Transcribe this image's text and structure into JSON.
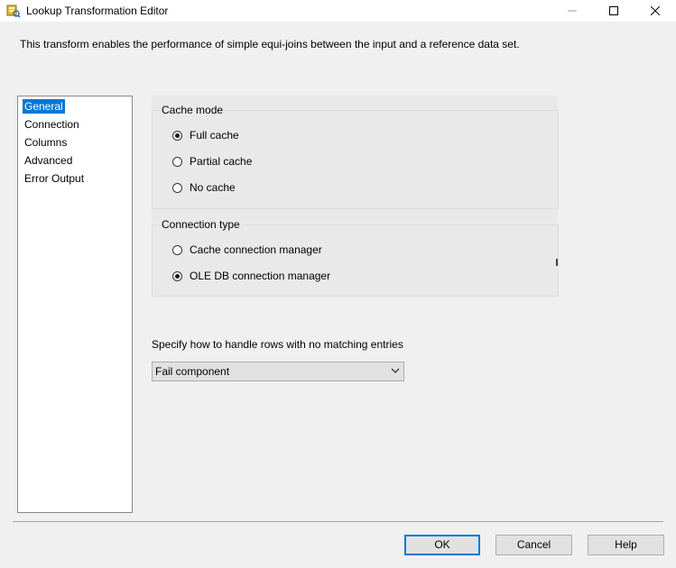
{
  "window": {
    "title": "Lookup Transformation Editor",
    "icon": "lookup-transform-icon"
  },
  "description": "This transform enables the performance of simple equi-joins between the input and a reference data set.",
  "nav": {
    "items": [
      {
        "label": "General",
        "selected": true
      },
      {
        "label": "Connection",
        "selected": false
      },
      {
        "label": "Columns",
        "selected": false
      },
      {
        "label": "Advanced",
        "selected": false
      },
      {
        "label": "Error Output",
        "selected": false
      }
    ],
    "selected_color": "#0078d7"
  },
  "cache_mode": {
    "title": "Cache mode",
    "options": [
      {
        "label": "Full cache",
        "checked": true
      },
      {
        "label": "Partial cache",
        "checked": false
      },
      {
        "label": "No cache",
        "checked": false
      }
    ]
  },
  "connection_type": {
    "title": "Connection type",
    "options": [
      {
        "label": "Cache connection manager",
        "checked": false
      },
      {
        "label": "OLE DB connection manager",
        "checked": true
      }
    ]
  },
  "no_match": {
    "label": "Specify how to handle rows with no matching entries",
    "selected": "Fail component"
  },
  "buttons": {
    "ok": "OK",
    "cancel": "Cancel",
    "help": "Help"
  }
}
